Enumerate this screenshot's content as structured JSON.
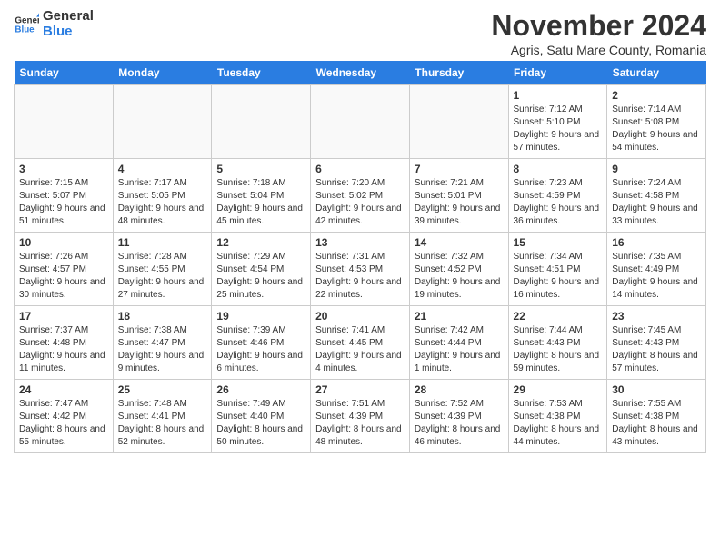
{
  "header": {
    "logo_line1": "General",
    "logo_line2": "Blue",
    "month_title": "November 2024",
    "subtitle": "Agris, Satu Mare County, Romania"
  },
  "weekdays": [
    "Sunday",
    "Monday",
    "Tuesday",
    "Wednesday",
    "Thursday",
    "Friday",
    "Saturday"
  ],
  "weeks": [
    [
      {
        "day": "",
        "info": ""
      },
      {
        "day": "",
        "info": ""
      },
      {
        "day": "",
        "info": ""
      },
      {
        "day": "",
        "info": ""
      },
      {
        "day": "",
        "info": ""
      },
      {
        "day": "1",
        "info": "Sunrise: 7:12 AM\nSunset: 5:10 PM\nDaylight: 9 hours and 57 minutes."
      },
      {
        "day": "2",
        "info": "Sunrise: 7:14 AM\nSunset: 5:08 PM\nDaylight: 9 hours and 54 minutes."
      }
    ],
    [
      {
        "day": "3",
        "info": "Sunrise: 7:15 AM\nSunset: 5:07 PM\nDaylight: 9 hours and 51 minutes."
      },
      {
        "day": "4",
        "info": "Sunrise: 7:17 AM\nSunset: 5:05 PM\nDaylight: 9 hours and 48 minutes."
      },
      {
        "day": "5",
        "info": "Sunrise: 7:18 AM\nSunset: 5:04 PM\nDaylight: 9 hours and 45 minutes."
      },
      {
        "day": "6",
        "info": "Sunrise: 7:20 AM\nSunset: 5:02 PM\nDaylight: 9 hours and 42 minutes."
      },
      {
        "day": "7",
        "info": "Sunrise: 7:21 AM\nSunset: 5:01 PM\nDaylight: 9 hours and 39 minutes."
      },
      {
        "day": "8",
        "info": "Sunrise: 7:23 AM\nSunset: 4:59 PM\nDaylight: 9 hours and 36 minutes."
      },
      {
        "day": "9",
        "info": "Sunrise: 7:24 AM\nSunset: 4:58 PM\nDaylight: 9 hours and 33 minutes."
      }
    ],
    [
      {
        "day": "10",
        "info": "Sunrise: 7:26 AM\nSunset: 4:57 PM\nDaylight: 9 hours and 30 minutes."
      },
      {
        "day": "11",
        "info": "Sunrise: 7:28 AM\nSunset: 4:55 PM\nDaylight: 9 hours and 27 minutes."
      },
      {
        "day": "12",
        "info": "Sunrise: 7:29 AM\nSunset: 4:54 PM\nDaylight: 9 hours and 25 minutes."
      },
      {
        "day": "13",
        "info": "Sunrise: 7:31 AM\nSunset: 4:53 PM\nDaylight: 9 hours and 22 minutes."
      },
      {
        "day": "14",
        "info": "Sunrise: 7:32 AM\nSunset: 4:52 PM\nDaylight: 9 hours and 19 minutes."
      },
      {
        "day": "15",
        "info": "Sunrise: 7:34 AM\nSunset: 4:51 PM\nDaylight: 9 hours and 16 minutes."
      },
      {
        "day": "16",
        "info": "Sunrise: 7:35 AM\nSunset: 4:49 PM\nDaylight: 9 hours and 14 minutes."
      }
    ],
    [
      {
        "day": "17",
        "info": "Sunrise: 7:37 AM\nSunset: 4:48 PM\nDaylight: 9 hours and 11 minutes."
      },
      {
        "day": "18",
        "info": "Sunrise: 7:38 AM\nSunset: 4:47 PM\nDaylight: 9 hours and 9 minutes."
      },
      {
        "day": "19",
        "info": "Sunrise: 7:39 AM\nSunset: 4:46 PM\nDaylight: 9 hours and 6 minutes."
      },
      {
        "day": "20",
        "info": "Sunrise: 7:41 AM\nSunset: 4:45 PM\nDaylight: 9 hours and 4 minutes."
      },
      {
        "day": "21",
        "info": "Sunrise: 7:42 AM\nSunset: 4:44 PM\nDaylight: 9 hours and 1 minute."
      },
      {
        "day": "22",
        "info": "Sunrise: 7:44 AM\nSunset: 4:43 PM\nDaylight: 8 hours and 59 minutes."
      },
      {
        "day": "23",
        "info": "Sunrise: 7:45 AM\nSunset: 4:43 PM\nDaylight: 8 hours and 57 minutes."
      }
    ],
    [
      {
        "day": "24",
        "info": "Sunrise: 7:47 AM\nSunset: 4:42 PM\nDaylight: 8 hours and 55 minutes."
      },
      {
        "day": "25",
        "info": "Sunrise: 7:48 AM\nSunset: 4:41 PM\nDaylight: 8 hours and 52 minutes."
      },
      {
        "day": "26",
        "info": "Sunrise: 7:49 AM\nSunset: 4:40 PM\nDaylight: 8 hours and 50 minutes."
      },
      {
        "day": "27",
        "info": "Sunrise: 7:51 AM\nSunset: 4:39 PM\nDaylight: 8 hours and 48 minutes."
      },
      {
        "day": "28",
        "info": "Sunrise: 7:52 AM\nSunset: 4:39 PM\nDaylight: 8 hours and 46 minutes."
      },
      {
        "day": "29",
        "info": "Sunrise: 7:53 AM\nSunset: 4:38 PM\nDaylight: 8 hours and 44 minutes."
      },
      {
        "day": "30",
        "info": "Sunrise: 7:55 AM\nSunset: 4:38 PM\nDaylight: 8 hours and 43 minutes."
      }
    ]
  ]
}
